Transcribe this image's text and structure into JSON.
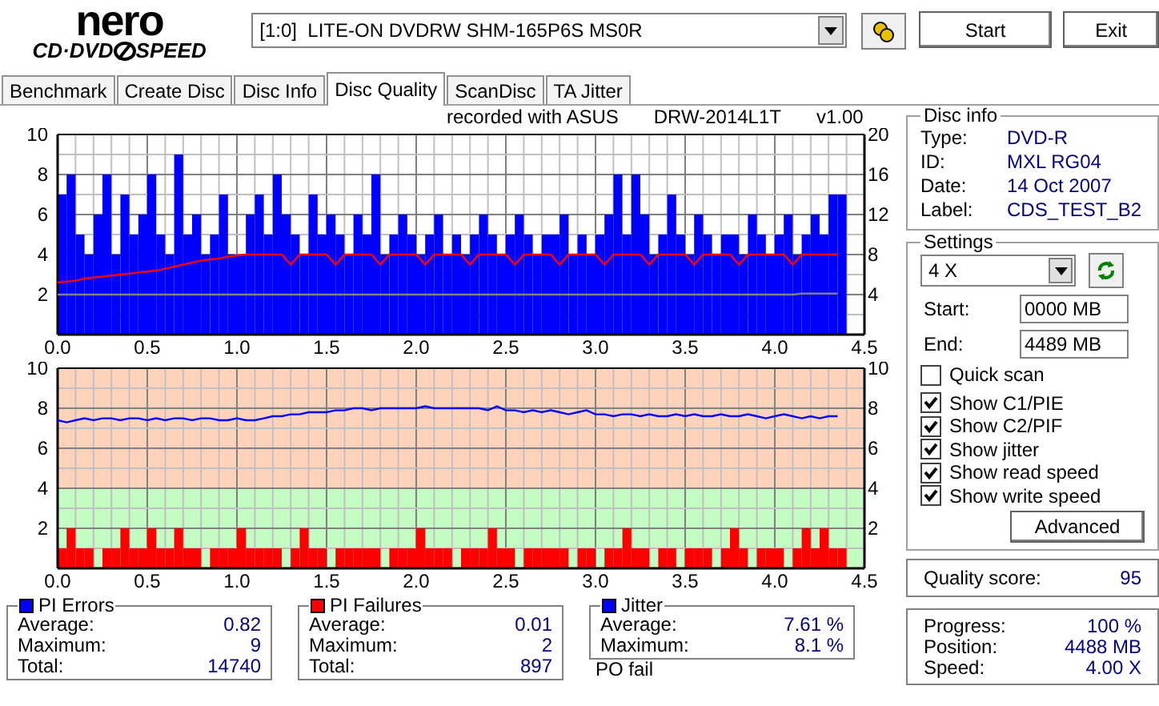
{
  "logo": {
    "brand": "nero",
    "product_left": "CD·DVD",
    "product_right": "SPEED"
  },
  "drive_select": {
    "value": "[1:0]  LITE-ON DVDRW SHM-165P6S MS0R"
  },
  "buttons": [
    {
      "label": "Start"
    },
    {
      "label": "Exit"
    }
  ],
  "tabs": [
    {
      "label": "Benchmark",
      "selected": false
    },
    {
      "label": "Create Disc",
      "selected": false
    },
    {
      "label": "Disc Info",
      "selected": false
    },
    {
      "label": "Disc Quality",
      "selected": true
    },
    {
      "label": "ScanDisc",
      "selected": false
    },
    {
      "label": "TA Jitter",
      "selected": false
    }
  ],
  "recorded_with": [
    "recorded with ASUS",
    "DRW-2014L1T",
    "v1.00"
  ],
  "charts": [
    {
      "bars": {
        "chart_data": {
          "type": "bar",
          "ylim": [
            0,
            10
          ],
          "xlim": [
            0,
            4.5
          ],
          "grid": true,
          "xticks": [
            {
              "value": 0,
              "label": "0.0"
            },
            {
              "value": 0.5,
              "label": "0.5"
            },
            {
              "value": 1,
              "label": "1.0"
            },
            {
              "value": 1.5,
              "label": "1.5"
            },
            {
              "value": 2,
              "label": "2.0"
            },
            {
              "value": 2.5,
              "label": "2.5"
            },
            {
              "value": 3,
              "label": "3.0"
            },
            {
              "value": 3.5,
              "label": "3.5"
            },
            {
              "value": 4,
              "label": "4.0"
            },
            {
              "value": 4.5,
              "label": "4.5"
            }
          ],
          "yticks": [
            2,
            4,
            6,
            8,
            10
          ],
          "x": [
            0,
            0.05,
            0.1,
            0.15,
            0.2,
            0.25,
            0.3,
            0.35,
            0.4,
            0.45,
            0.5,
            0.55,
            0.6,
            0.65,
            0.7,
            0.75,
            0.8,
            0.85,
            0.9,
            0.95,
            1,
            1.05,
            1.1,
            1.15,
            1.2,
            1.25,
            1.3,
            1.35,
            1.4,
            1.45,
            1.5,
            1.55,
            1.6,
            1.65,
            1.7,
            1.75,
            1.8,
            1.85,
            1.9,
            1.95,
            2,
            2.05,
            2.1,
            2.15,
            2.2,
            2.25,
            2.3,
            2.35,
            2.4,
            2.45,
            2.5,
            2.55,
            2.6,
            2.65,
            2.7,
            2.75,
            2.8,
            2.85,
            2.9,
            2.95,
            3,
            3.05,
            3.1,
            3.15,
            3.2,
            3.25,
            3.3,
            3.35,
            3.4,
            3.45,
            3.5,
            3.55,
            3.6,
            3.65,
            3.7,
            3.75,
            3.8,
            3.85,
            3.9,
            3.95,
            4,
            4.05,
            4.1,
            4.15,
            4.2,
            4.25,
            4.3,
            4.35
          ],
          "series": [
            {
              "color": "#0000ff",
              "values": [
                7,
                8,
                5,
                4,
                6,
                8,
                4,
                7,
                5,
                6,
                8,
                5,
                4,
                9,
                5,
                6,
                4,
                5,
                7,
                4,
                4,
                6,
                7,
                5,
                8,
                6,
                5,
                4,
                7,
                5,
                6,
                5,
                4,
                6,
                5,
                8,
                4,
                5,
                6,
                5,
                4,
                5,
                6,
                4,
                5,
                4,
                5,
                6,
                5,
                4,
                5,
                6,
                5,
                4,
                5,
                5,
                6,
                4,
                5,
                4,
                5,
                6,
                8,
                5,
                8,
                6,
                4,
                5,
                7,
                5,
                4,
                6,
                5,
                4,
                5,
                5,
                4,
                6,
                5,
                4,
                5,
                6,
                4,
                5,
                6,
                5,
                7,
                7
              ]
            }
          ]
        }
      },
      "lines": {
        "chart_data": {
          "type": "line",
          "ylim": [
            0,
            20
          ],
          "xlim": [
            0,
            4.5
          ],
          "yticks": [
            4,
            8,
            12,
            16,
            20
          ],
          "x": [
            0,
            0.05,
            0.1,
            0.15,
            0.2,
            0.25,
            0.3,
            0.35,
            0.4,
            0.45,
            0.5,
            0.55,
            0.6,
            0.65,
            0.7,
            0.75,
            0.8,
            0.85,
            0.9,
            0.95,
            1,
            1.05,
            1.1,
            1.15,
            1.2,
            1.25,
            1.3,
            1.35,
            1.4,
            1.45,
            1.5,
            1.55,
            1.6,
            1.65,
            1.7,
            1.75,
            1.8,
            1.85,
            1.9,
            1.95,
            2,
            2.05,
            2.1,
            2.15,
            2.2,
            2.25,
            2.3,
            2.35,
            2.4,
            2.45,
            2.5,
            2.55,
            2.6,
            2.65,
            2.7,
            2.75,
            2.8,
            2.85,
            2.9,
            2.95,
            3,
            3.05,
            3.1,
            3.15,
            3.2,
            3.25,
            3.3,
            3.35,
            3.4,
            3.45,
            3.5,
            3.55,
            3.6,
            3.65,
            3.7,
            3.75,
            3.8,
            3.85,
            3.9,
            3.95,
            4,
            4.05,
            4.1,
            4.15,
            4.2,
            4.25,
            4.3,
            4.35
          ],
          "series": [
            {
              "color": "#ff0000",
              "values": [
                5.2,
                5.3,
                5.4,
                5.6,
                5.7,
                5.8,
                5.9,
                6,
                6.1,
                6.2,
                6.3,
                6.4,
                6.6,
                6.8,
                7,
                7.2,
                7.4,
                7.5,
                7.6,
                7.8,
                7.9,
                8,
                8,
                8,
                8,
                8,
                7,
                8,
                8,
                8,
                8,
                7,
                8,
                8,
                8,
                8,
                7,
                8,
                8,
                8,
                8,
                7,
                8,
                8,
                8,
                8,
                7,
                8,
                8,
                8,
                8,
                7,
                8,
                8,
                8,
                8,
                7,
                8,
                8,
                8,
                8,
                7,
                8,
                8,
                8,
                8,
                7,
                8,
                8,
                8,
                8,
                7,
                8,
                8,
                8,
                8,
                7,
                8,
                8,
                8,
                8,
                8,
                7,
                8,
                8,
                8,
                8,
                8
              ]
            },
            {
              "color": "#808080",
              "values": [
                4,
                4,
                4,
                4,
                4,
                4,
                4,
                4,
                4,
                4,
                4,
                4,
                4,
                4,
                4,
                4,
                4,
                4,
                4,
                4,
                4,
                4,
                4,
                4,
                4,
                4,
                4,
                4,
                4,
                4,
                4,
                4,
                4,
                4,
                4,
                4,
                4,
                4,
                4,
                4,
                4,
                4,
                4,
                4,
                4,
                4,
                4,
                4,
                4,
                4,
                4,
                4,
                4,
                4,
                4,
                4,
                4,
                4,
                4,
                4,
                4,
                4,
                4,
                4,
                4,
                4,
                4,
                4,
                4,
                4,
                4,
                4,
                4,
                4,
                4,
                4,
                4,
                4,
                4,
                4,
                4,
                4,
                4,
                4.1,
                4.1,
                4.1,
                4.1,
                4.1
              ]
            }
          ]
        }
      }
    },
    {
      "bars": {
        "chart_data": {
          "type": "bar",
          "ylim": [
            0,
            10
          ],
          "xlim": [
            0,
            4.5
          ],
          "grid": true,
          "bands": [
            {
              "axis": "y",
              "from": 4,
              "to": 10,
              "color": "#ffd2bc"
            },
            {
              "axis": "y",
              "from": 0,
              "to": 4,
              "color": "#c4fcc4"
            }
          ],
          "xticks": [
            {
              "value": 0,
              "label": "0.0"
            },
            {
              "value": 0.5,
              "label": "0.5"
            },
            {
              "value": 1,
              "label": "1.0"
            },
            {
              "value": 1.5,
              "label": "1.5"
            },
            {
              "value": 2,
              "label": "2.0"
            },
            {
              "value": 2.5,
              "label": "2.5"
            },
            {
              "value": 3,
              "label": "3.0"
            },
            {
              "value": 3.5,
              "label": "3.5"
            },
            {
              "value": 4,
              "label": "4.0"
            },
            {
              "value": 4.5,
              "label": "4.5"
            }
          ],
          "yticks": [
            2,
            4,
            6,
            8,
            10
          ],
          "x": [
            0,
            0.05,
            0.1,
            0.15,
            0.2,
            0.25,
            0.3,
            0.35,
            0.4,
            0.45,
            0.5,
            0.55,
            0.6,
            0.65,
            0.7,
            0.75,
            0.8,
            0.85,
            0.9,
            0.95,
            1,
            1.05,
            1.1,
            1.15,
            1.2,
            1.25,
            1.3,
            1.35,
            1.4,
            1.45,
            1.5,
            1.55,
            1.6,
            1.65,
            1.7,
            1.75,
            1.8,
            1.85,
            1.9,
            1.95,
            2,
            2.05,
            2.1,
            2.15,
            2.2,
            2.25,
            2.3,
            2.35,
            2.4,
            2.45,
            2.5,
            2.55,
            2.6,
            2.65,
            2.7,
            2.75,
            2.8,
            2.85,
            2.9,
            2.95,
            3,
            3.05,
            3.1,
            3.15,
            3.2,
            3.25,
            3.3,
            3.35,
            3.4,
            3.45,
            3.5,
            3.55,
            3.6,
            3.65,
            3.7,
            3.75,
            3.8,
            3.85,
            3.9,
            3.95,
            4,
            4.05,
            4.1,
            4.15,
            4.2,
            4.25,
            4.3,
            4.35
          ],
          "series": [
            {
              "color": "#ff0000",
              "values": [
                1,
                2,
                1,
                1,
                0,
                1,
                1,
                2,
                1,
                1,
                2,
                1,
                1,
                2,
                1,
                1,
                0,
                1,
                1,
                1,
                2,
                1,
                1,
                1,
                1,
                0,
                1,
                2,
                1,
                1,
                0,
                1,
                1,
                1,
                1,
                1,
                0,
                1,
                1,
                1,
                2,
                1,
                1,
                1,
                0,
                1,
                1,
                1,
                2,
                1,
                1,
                0,
                1,
                1,
                1,
                1,
                1,
                0,
                1,
                1,
                0,
                1,
                1,
                2,
                1,
                1,
                0,
                1,
                1,
                0,
                1,
                1,
                1,
                0,
                1,
                2,
                1,
                0,
                1,
                1,
                1,
                0,
                1,
                2,
                1,
                2,
                1,
                1
              ]
            }
          ]
        }
      },
      "lines": {
        "chart_data": {
          "type": "line",
          "ylim": [
            0,
            10
          ],
          "xlim": [
            0,
            4.5
          ],
          "yticks": [
            2,
            4,
            6,
            8,
            10
          ],
          "x": [
            0,
            0.05,
            0.1,
            0.15,
            0.2,
            0.25,
            0.3,
            0.35,
            0.4,
            0.45,
            0.5,
            0.55,
            0.6,
            0.65,
            0.7,
            0.75,
            0.8,
            0.85,
            0.9,
            0.95,
            1,
            1.05,
            1.1,
            1.15,
            1.2,
            1.25,
            1.3,
            1.35,
            1.4,
            1.45,
            1.5,
            1.55,
            1.6,
            1.65,
            1.7,
            1.75,
            1.8,
            1.85,
            1.9,
            1.95,
            2,
            2.05,
            2.1,
            2.15,
            2.2,
            2.25,
            2.3,
            2.35,
            2.4,
            2.45,
            2.5,
            2.55,
            2.6,
            2.65,
            2.7,
            2.75,
            2.8,
            2.85,
            2.9,
            2.95,
            3,
            3.05,
            3.1,
            3.15,
            3.2,
            3.25,
            3.3,
            3.35,
            3.4,
            3.45,
            3.5,
            3.55,
            3.6,
            3.65,
            3.7,
            3.75,
            3.8,
            3.85,
            3.9,
            3.95,
            4,
            4.05,
            4.1,
            4.15,
            4.2,
            4.25,
            4.3,
            4.35
          ],
          "series": [
            {
              "color": "#0000ff",
              "values": [
                7.4,
                7.3,
                7.4,
                7.5,
                7.4,
                7.5,
                7.5,
                7.4,
                7.5,
                7.5,
                7.4,
                7.5,
                7.4,
                7.5,
                7.5,
                7.4,
                7.5,
                7.5,
                7.4,
                7.4,
                7.5,
                7.4,
                7.4,
                7.5,
                7.6,
                7.6,
                7.7,
                7.7,
                7.8,
                7.8,
                7.8,
                7.9,
                7.9,
                8,
                8,
                7.9,
                8,
                8,
                8,
                8,
                8,
                8.1,
                8,
                8,
                8,
                8,
                8,
                8,
                7.9,
                8.1,
                7.9,
                7.9,
                7.8,
                7.9,
                7.8,
                7.9,
                7.8,
                7.7,
                7.8,
                7.9,
                7.7,
                7.7,
                7.6,
                7.7,
                7.7,
                7.6,
                7.7,
                7.6,
                7.6,
                7.7,
                7.6,
                7.7,
                7.6,
                7.6,
                7.7,
                7.6,
                7.6,
                7.7,
                7.6,
                7.5,
                7.6,
                7.7,
                7.6,
                7.5,
                7.6,
                7.5,
                7.6,
                7.6
              ]
            }
          ]
        }
      }
    }
  ],
  "stats": [
    {
      "title": "PI Errors",
      "color": "#0000ff",
      "rows": [
        {
          "label": "Average:",
          "value": "0.82"
        },
        {
          "label": "Maximum:",
          "value": "9"
        },
        {
          "label": "Total:",
          "value": "14740"
        }
      ]
    },
    {
      "title": "PI Failures",
      "color": "#ff0000",
      "rows": [
        {
          "label": "Average:",
          "value": "0.01"
        },
        {
          "label": "Maximum:",
          "value": "2"
        },
        {
          "label": "Total:",
          "value": "897"
        }
      ]
    },
    {
      "title": "Jitter",
      "color": "#0000ff",
      "rows": [
        {
          "label": "Average:",
          "value": "7.61 %"
        },
        {
          "label": "Maximum:",
          "value": "8.1 %"
        }
      ]
    }
  ],
  "po_failures_label": "PO fail",
  "disc_info": {
    "title": "Disc info",
    "rows": [
      {
        "label": "Type:",
        "value": "DVD-R"
      },
      {
        "label": "ID:",
        "value": "MXL RG04"
      },
      {
        "label": "Date:",
        "value": "14 Oct 2007"
      },
      {
        "label": "Label:",
        "value": "CDS_TEST_B2"
      }
    ]
  },
  "settings": {
    "title": "Settings",
    "speed": "4 X",
    "start_label": "Start:",
    "start_value": "0000 MB",
    "end_label": "End:",
    "end_value": "4489 MB",
    "options": [
      {
        "label": "Quick scan",
        "checked": false
      },
      {
        "label": "Show C1/PIE",
        "checked": true
      },
      {
        "label": "Show C2/PIF",
        "checked": true
      },
      {
        "label": "Show jitter",
        "checked": true
      },
      {
        "label": "Show read speed",
        "checked": true
      },
      {
        "label": "Show write speed",
        "checked": true
      }
    ],
    "advanced_button": "Advanced"
  },
  "quality_score": {
    "label": "Quality score:",
    "value": "95"
  },
  "progress": [
    {
      "label": "Progress:",
      "value": "100 %"
    },
    {
      "label": "Position:",
      "value": "4488 MB"
    },
    {
      "label": "Speed:",
      "value": "4.00 X"
    }
  ]
}
